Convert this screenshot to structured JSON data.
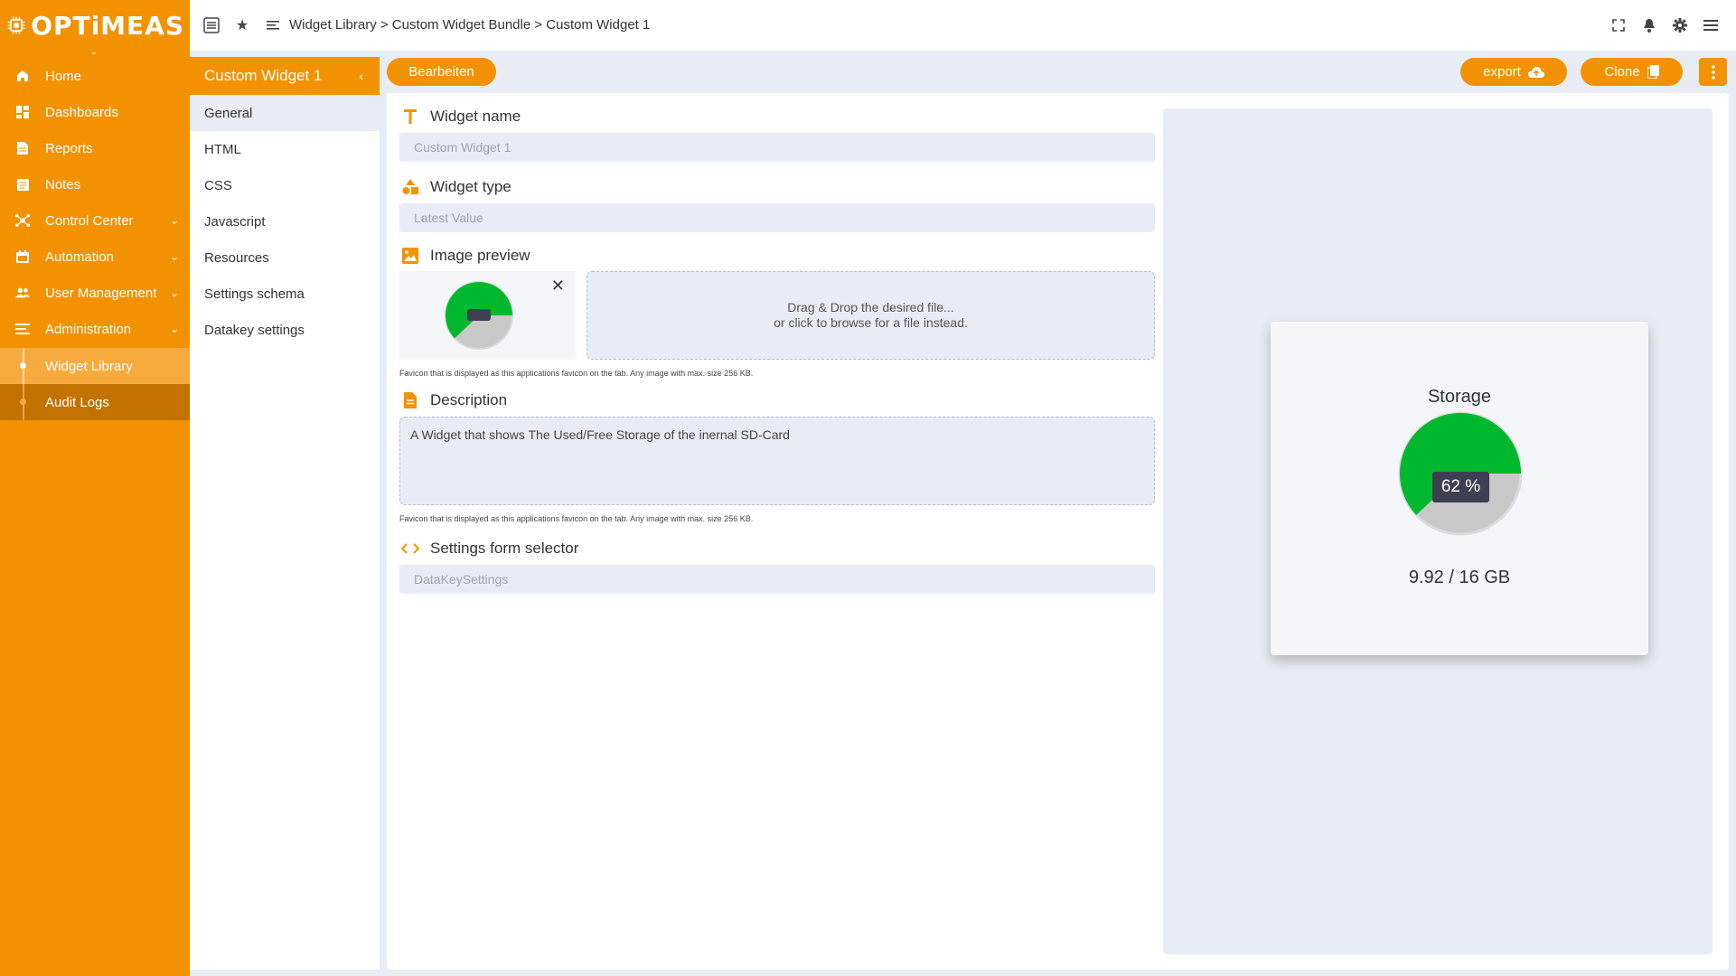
{
  "brand": {
    "name": "OPTiMEAS"
  },
  "sidebar": {
    "items": [
      {
        "label": "Home",
        "icon": "home-icon"
      },
      {
        "label": "Dashboards",
        "icon": "dashboard-icon"
      },
      {
        "label": "Reports",
        "icon": "report-icon"
      },
      {
        "label": "Notes",
        "icon": "notes-icon"
      },
      {
        "label": "Control Center",
        "icon": "control-center-icon"
      },
      {
        "label": "Automation",
        "icon": "calendar-icon"
      },
      {
        "label": "User Management",
        "icon": "users-icon"
      },
      {
        "label": "Administration",
        "icon": "admin-icon"
      },
      {
        "label": "Widget Library"
      },
      {
        "label": "Audit Logs"
      }
    ]
  },
  "header": {
    "breadcrumb": "Widget Library > Custom Widget Bundle > Custom Widget 1"
  },
  "secnav": {
    "title": "Custom Widget 1",
    "items": [
      "General",
      "HTML",
      "CSS",
      "Javascript",
      "Resources",
      "Settings schema",
      "Datakey settings"
    ]
  },
  "toolbar": {
    "edit_label": "Bearbeiten",
    "export_label": "export",
    "clone_label": "Clone"
  },
  "form": {
    "widget_name": {
      "label": "Widget name",
      "value": "Custom Widget 1"
    },
    "widget_type": {
      "label": "Widget type",
      "value": "Latest Value"
    },
    "image_preview": {
      "label": "Image preview",
      "drop_line1": "Drag & Drop the desired file...",
      "drop_line2": "or click to browse for a file instead.",
      "hint": "Favicon that is displayed as this applications favicon on the tab. Any image with max. size 256 KB."
    },
    "description": {
      "label": "Description",
      "value": "A Widget that shows The Used/Free Storage of the inernal SD-Card",
      "hint": "Favicon that is displayed as this applications favicon on the tab. Any image with max. size 256 KB."
    },
    "settings_form_selector": {
      "label": "Settings form selector",
      "value": "DataKeySettings"
    }
  },
  "widget_preview": {
    "title": "Storage",
    "percent_label": "62 %",
    "usage_label": "9.92 / 16 GB",
    "used_fraction": 0.62,
    "colors": {
      "used": "#00b82e",
      "free": "#c8c8c8",
      "accent": "#f39200"
    }
  }
}
